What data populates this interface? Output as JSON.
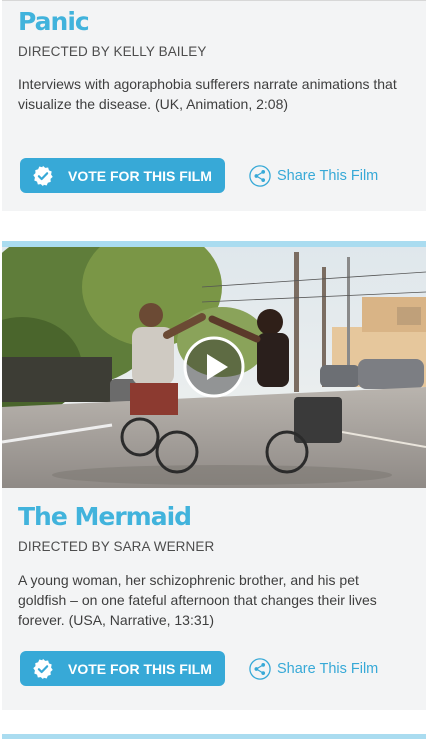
{
  "films": [
    {
      "title": "Panic",
      "director": "DIRECTED BY KELLY BAILEY",
      "description": "Interviews with agoraphobia sufferers narrate animations that visualize the disease. (UK, Animation, 2:08)",
      "vote_label": "VOTE FOR THIS FILM",
      "share_label": "Share This Film"
    },
    {
      "title": "The Mermaid",
      "director": "DIRECTED BY SARA WERNER",
      "description": "A young woman, her schizophrenic brother, and his pet goldfish – on one fateful afternoon that changes their lives forever. (USA, Narrative, 13:31)",
      "vote_label": "VOTE FOR THIS FILM",
      "share_label": "Share This Film"
    }
  ],
  "icons": {
    "vote_badge": "check-badge-icon",
    "share": "share-icon",
    "play": "play-icon"
  },
  "colors": {
    "accent": "#37a9d7",
    "title": "#41b3dc",
    "card_bg": "#f3f4f5",
    "divider": "#aadcf0"
  }
}
